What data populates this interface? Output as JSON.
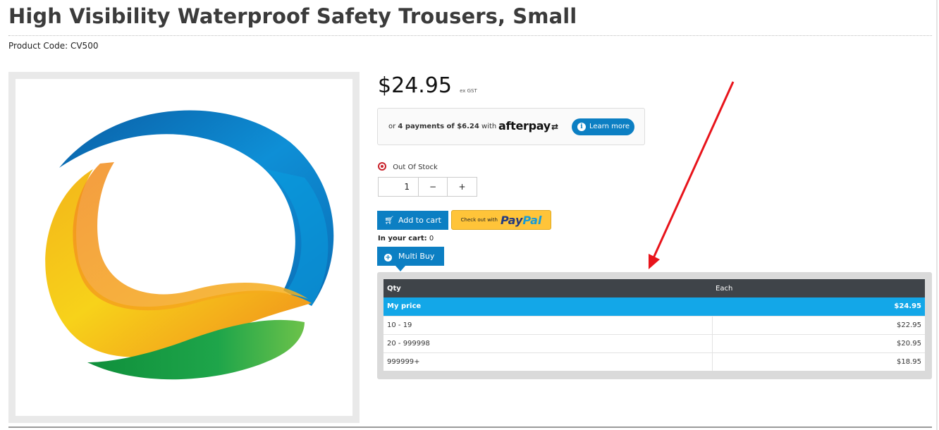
{
  "product": {
    "title": "High Visibility Waterproof Safety Trousers, Small",
    "code_label": "Product Code:",
    "code": "CV500"
  },
  "pricing": {
    "price": "$24.95",
    "tax_note": "ex GST"
  },
  "afterpay": {
    "prefix": "or",
    "payments": "4 payments of $6.24",
    "suffix": "with",
    "logo_text": "afterpay",
    "learn_more": "Learn more"
  },
  "stock": {
    "status": "Out Of Stock",
    "status_color": "#c9232c"
  },
  "quantity": {
    "value": "1",
    "minus": "−",
    "plus": "+"
  },
  "actions": {
    "add_to_cart": "Add to cart",
    "paypal_prefix": "Check out with",
    "paypal_pay": "Pay",
    "paypal_pal": "Pal",
    "in_cart_label": "In your cart:",
    "in_cart_count": "0",
    "multi_buy": "Multi Buy"
  },
  "multi_buy": {
    "headers": [
      "Qty",
      "Each"
    ],
    "my_price": {
      "qty": "My price",
      "each": "$24.95"
    },
    "tiers": [
      {
        "qty": "10 - 19",
        "each": "$22.95"
      },
      {
        "qty": "20 - 999998",
        "each": "$20.95"
      },
      {
        "qty": "999999+",
        "each": "$18.95"
      }
    ]
  },
  "colors": {
    "accent": "#0c7fc3",
    "my_price_row": "#13a7e8",
    "table_header": "#3f4449",
    "annotation_arrow": "#e8141b"
  }
}
